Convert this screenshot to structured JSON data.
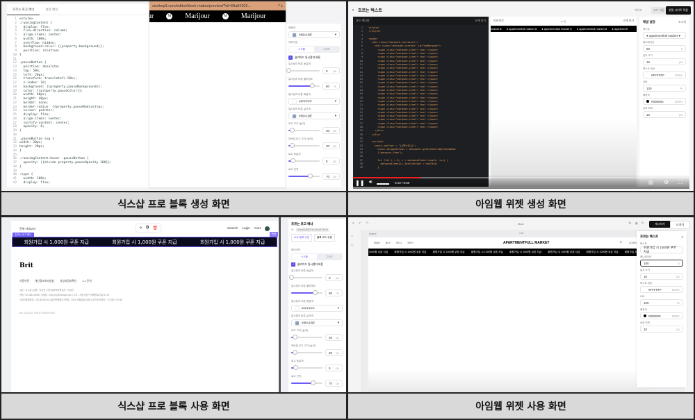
{
  "captions": [
    "식스샵 프로 블록 생성 화면",
    "아임웹 위젯 생성 화면",
    "식스샵 프로 블록 사용 화면",
    "아임웹 위젯 사용 화면"
  ],
  "q1": {
    "tabs": [
      "흐르는 로고 배너",
      "설정 패널"
    ],
    "code": [
      "<style>",
      ".runningContent {",
      "  display: flex;",
      "  flex-direction: column;",
      "  align-items: center;",
      "  width: 100%;",
      "  overflow: hidden;",
      "  background-color: {{property.background}};",
      "  position: relative;",
      "}",
      "",
      ".pauseButton {",
      "  position: absolute;",
      "  top: 50%;",
      "  left: 20px;",
      "  transform: translateY(-50%);",
      "  z-index: 10;",
      "  background: {{property.pauseBackground}};",
      "  color: {{property.pauseColor}};",
      "  width: 40px;",
      "  height: 40px;",
      "  border: none;",
      "  border-radius: {{property.pauseRadius}}px;",
      "  cursor: pointer;",
      "  display: flex;",
      "  align-items: center;",
      "  justify-content: center;",
      "  opacity: 0;",
      "}",
      "",
      ".pauseButton svg {",
      "width: 20px;",
      "height: 20px;",
      "}",
      "",
      ".runningContent:hover .pauseButton {",
      "  opacity: {{divide property.pauseOpacity 100}};",
      "}",
      "",
      ".type {",
      "  width: 100%;",
      "  display: flex;"
    ],
    "url": "sixshop3.com/editor/block-maker/preview/?id=69a94102...",
    "logo_text": "Marijour",
    "logo_partial": "ur",
    "logo_mark": "M",
    "settings": {
      "bg_label": "배경색",
      "bg_value": "#89A1BE",
      "layout_label": "레이아웃",
      "layout_options": [
        "스크롤",
        "그리드"
      ],
      "checkbox_label": "슬라이드 일시정지 버튼",
      "radius_label": "일시정지 버튼 둥글게",
      "radius_value": "0",
      "radius_unit": "px",
      "radius_pct": 0,
      "opacity_label": "일시정지 버튼 불투명도",
      "opacity_value": "80",
      "opacity_unit": "%",
      "opacity_pct": 75,
      "btnbg_label": "일시정지 버튼 배경색",
      "btnbg_value": "#FFFFFF",
      "btnfg_label": "일시정지 버튼 글자색",
      "btnfg_value": "#89A1BE",
      "logo_size_label": "로고 크기 (높이)",
      "logo_size_value": "30",
      "logo_size_pct": 10,
      "mlogo_size_label": "모바일 로고 크기 (높이)",
      "mlogo_size_value": "30",
      "mlogo_size_pct": 10,
      "logo_radius_label": "로고 둥글게",
      "logo_radius_value": "5",
      "logo_radius_pct": 14,
      "logo_gap_label": "로고 간격",
      "logo_gap_value": "70",
      "logo_gap_pct": 68,
      "px": "px"
    }
  },
  "q2": {
    "title": "흐르는 텍스트",
    "guide": "가이드",
    "code_btn": "코드 저장",
    "apply_btn": "위젯 사이트 적용",
    "editor_title": "코드 에디터",
    "editor_expand": "크게 보기",
    "code": [
      "  <style>",
      "  </style>",
      "",
      "  <body>",
      "    <div class=\"marquee-container\">",
      "      <div class=\"marquee-content\" id=\"myMarquee\">",
      "        <span class=\"marquee-item\"> text </span>",
      "        <span class=\"marquee-item\"> text </span>",
      "        <span class=\"marquee-item\"> text </span>",
      "        <span class=\"marquee-item\"> text </span>",
      "        <span class=\"marquee-item\"> text </span>",
      "        <span class=\"marquee-item\"> text </span>",
      "        <span class=\"marquee-item\"> text </span>",
      "        <span class=\"marquee-item\"> text </span>",
      "        <span class=\"marquee-item\"> text </span>",
      "        <span class=\"marquee-item\"> text </span>",
      "        <span class=\"marquee-item\"> text </span>",
      "        <span class=\"marquee-item\"> text </span>",
      "        <span class=\"marquee-item\"> text </span>",
      "        <span class=\"marquee-item\"> text </span>",
      "        <span class=\"marquee-item\"> text </span>",
      "        <span class=\"marquee-item\"> text </span>",
      "        <span class=\"marquee-item\"> text </span>",
      "        <span class=\"marquee-item\"> text </span>",
      "        <span class=\"marquee-item\"> text </span>",
      "        <span class=\"marquee-item\"> text </span>",
      "        <span class=\"marquee-item\"> text </span>",
      "        <span class=\"marquee-item\"> text </span>",
      "      </div>",
      "    </div>",
      "",
      "    <script>",
      "      const newText = \"{{텍스트}}\";",
      "        const marqueeItems = document.getElementsByClassName",
      "        ('marquee-item');",
      "",
      "        for (let i = 0; i < marqueeItems.length; i++) {",
      "          marqueeItems[i].textContent = newText;",
      "        }"
    ],
    "preview_title": "미리보기",
    "preview_expand": "크게 보기",
    "marquee": [
      "market ●",
      "● apartmentfull market ●",
      "● apartmentfull market ●",
      "● apartmentfull market ●",
      "● apartmentf"
    ],
    "panel_title": "패널 설정",
    "reset": "초기화",
    "fields": [
      {
        "label": "텍스트",
        "value": "● apartmentfull market ●",
        "unit": ""
      },
      {
        "label": "애니메이션",
        "value": "60",
        "unit": "s"
      },
      {
        "label": "글자 크기",
        "value": "16",
        "unit": "px"
      },
      {
        "label": "텍스트 색상",
        "value": "#FFFFFF",
        "unit": "100%"
      },
      {
        "label": "너비",
        "value": "100",
        "unit": "%"
      },
      {
        "label": "배경색",
        "value": "#000000",
        "unit": "100%"
      },
      {
        "label": "상하 여백",
        "value": "10",
        "unit": "px"
      }
    ],
    "time": "0:10 / 0:50",
    "progress": 0.2
  },
  "q3": {
    "category": "전체 카테고리",
    "nav": [
      "Search",
      "Login",
      "Cart"
    ],
    "block_tag": "흐르는 로고 배너",
    "section_tag": "섹션",
    "banner": [
      "회원가입 시 1,000원 쿠폰 지급",
      "회원가입 시 1,000원 쿠폰 지급",
      "회원가입 시 1,000원 쿠폰 지급"
    ],
    "brand": "Brit",
    "footer_links": [
      "이용약관",
      "개인정보처리방침",
      "사업자정보확인",
      "1:1 문의"
    ],
    "footer_lines": [
      "상호 : 식스샵 | 대표 : 이상현 | 개인정보보호책임자 : 이상현",
      "전화 : 02-1644-6608 | 이메일 : help-pro@sixshop.com | 주소 : 서울 강남구 테헤란로79길 11 4F",
      "사업자등록번호 : 211-88-81910 | 통신판매업신고번호 : 2023-서울강남-0650 | 호스팅 제공자 : 주식회사 식스샵"
    ],
    "copyright": "Brit. 2026 ALL RIGHTS RESERVED",
    "panel_title": "흐르는 로고 배너",
    "id_label": "ID",
    "id_value": "69a94b38537bc16a387d93d",
    "ai_btn": "AI로 블록 수정",
    "code_btn": "블록 코드 수정"
  },
  "q4": {
    "page": "Main",
    "publish": "게시하기",
    "exit": "나가기",
    "home": "Home",
    "nav": [
      "MAIN",
      "BUY",
      "SELL",
      "INFO"
    ],
    "brand": "APARTMENTFULL MARKET",
    "login": "LOGIN",
    "marquee_item": "회원가입 시 1000원 쿠폰 지급",
    "panel_title": "흐르는 텍스트",
    "fields": [
      {
        "label": "텍스트",
        "value": "회원가입 시 1000원 쿠폰 지급",
        "unit": ""
      },
      {
        "label": "애니메이션",
        "value": "100",
        "unit": "s"
      },
      {
        "label": "글자 크기",
        "value": "16",
        "unit": "px"
      },
      {
        "label": "텍스트 색상",
        "value": "#FFFFFF",
        "unit": "100%"
      },
      {
        "label": "너비",
        "value": "100",
        "unit": "%"
      },
      {
        "label": "배경색",
        "value": "#000000",
        "unit": "100%"
      },
      {
        "label": "상하 여백",
        "value": "10",
        "unit": "px"
      }
    ]
  },
  "colors": {
    "accent": "#6b5cf6",
    "swatch": "#89A1BE"
  }
}
